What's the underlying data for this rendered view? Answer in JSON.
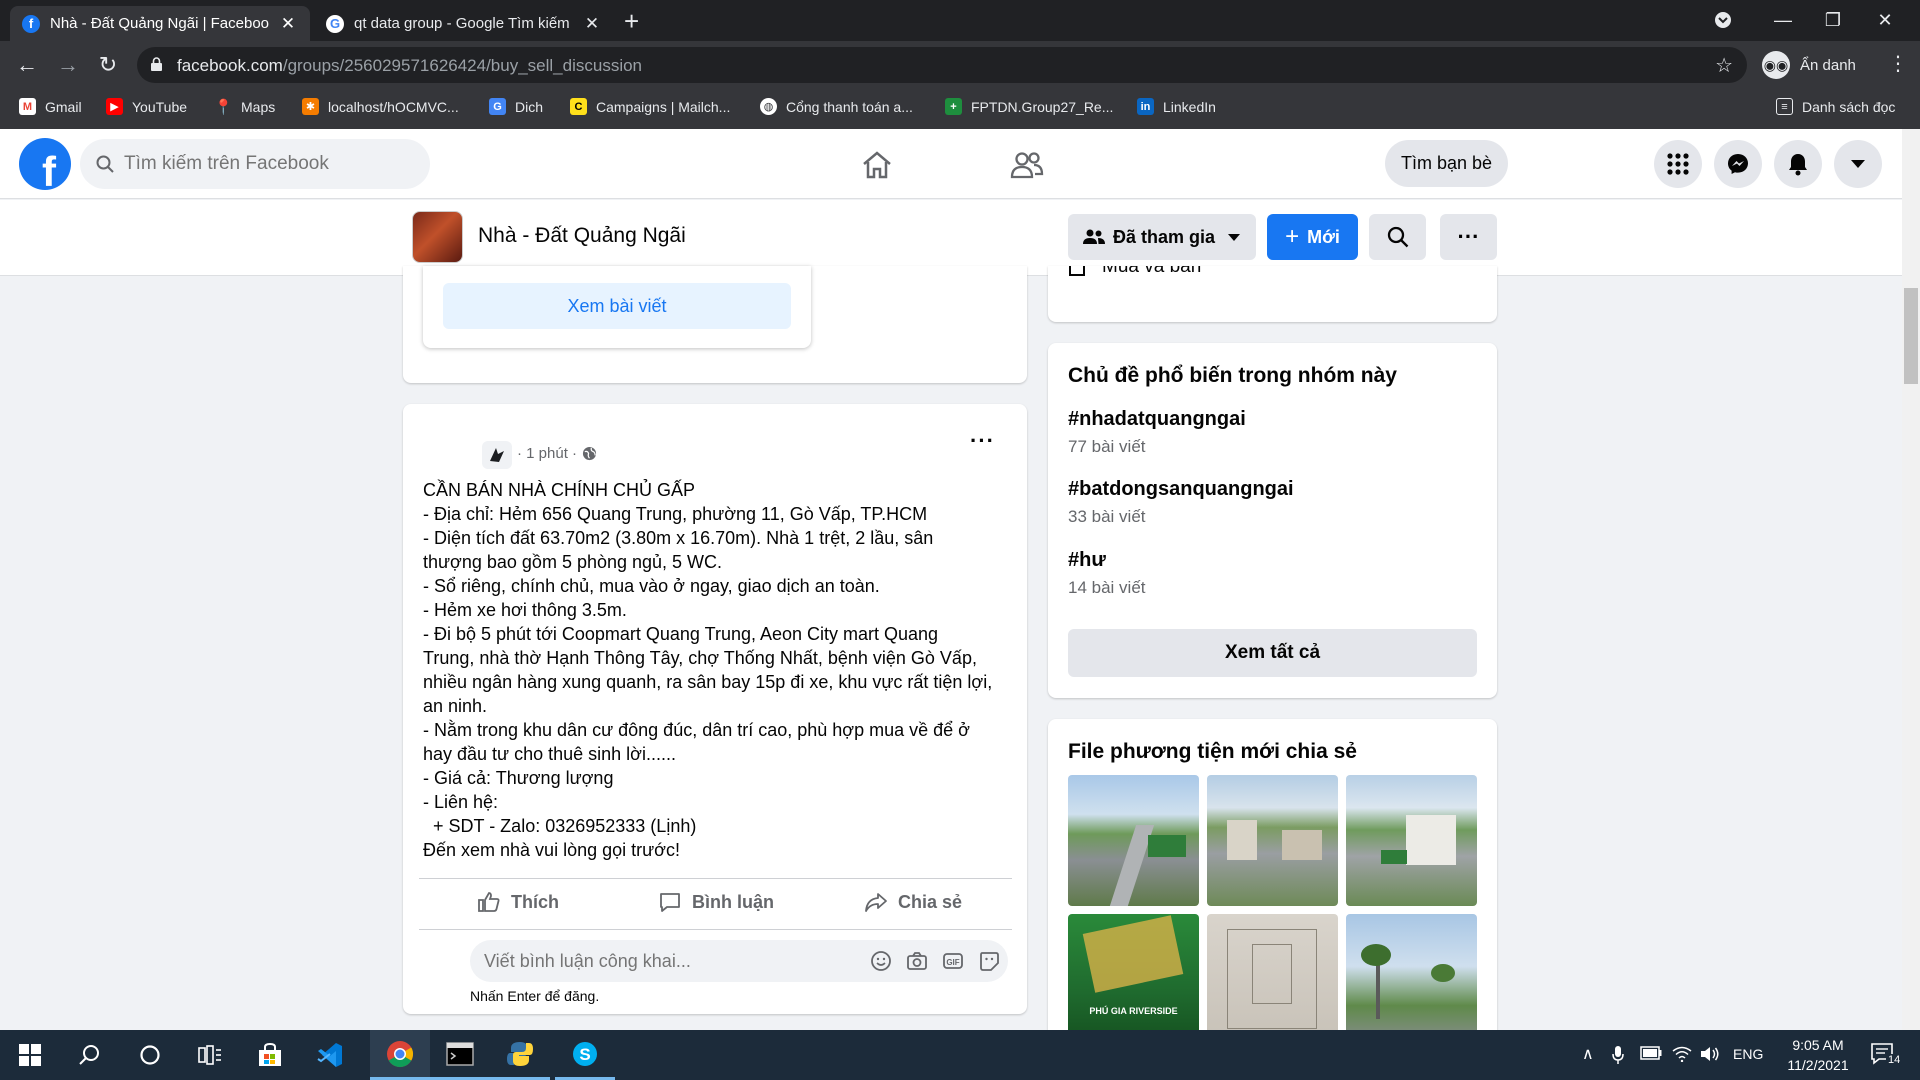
{
  "browser": {
    "tabs": [
      {
        "title": "Nhà - Đất Quảng Ngãi | Facebook",
        "active": true
      },
      {
        "title": "qt data group - Google Tìm kiếm",
        "active": false
      }
    ],
    "url_host": "facebook.com",
    "url_path": "/groups/256029571626424/buy_sell_discussion",
    "profile_label": "Ẩn danh",
    "bookmarks": [
      "Gmail",
      "YouTube",
      "Maps",
      "localhost/hOCMVC...",
      "Dich",
      "Campaigns | Mailch...",
      "Cổng thanh toán a...",
      "FPTDN.Group27_Re...",
      "LinkedIn"
    ],
    "reading_list": "Danh sách đọc"
  },
  "fb": {
    "search_placeholder": "Tìm kiếm trên Facebook",
    "find_friends": "Tìm bạn bè",
    "group_name": "Nhà - Đất Quảng Ngãi",
    "joined_label": "Đã tham gia",
    "new_label": "Mới",
    "partial_item": "Mua và bán",
    "view_post": "Xem bài viết"
  },
  "post": {
    "time": "· 1 phút ·",
    "lines": [
      "CẦN BÁN NHÀ CHÍNH CHỦ GẤP",
      "- Địa chỉ: Hẻm 656 Quang Trung, phường 11,  Gò Vấp, TP.HCM",
      "- Diện tích đất 63.70m2 (3.80m x 16.70m). Nhà 1 trệt, 2 lầu, sân",
      "thượng bao gồm 5 phòng ngủ, 5 WC.",
      "- Sổ riêng, chính chủ, mua vào ở ngay, giao dịch an toàn.",
      "- Hẻm xe hơi thông 3.5m.",
      "- Đi bộ 5 phút tới Coopmart Quang Trung, Aeon City mart Quang",
      "Trung, nhà thờ Hạnh Thông Tây, chợ Thống Nhất, bệnh viện Gò Vấp,",
      "nhiều ngân hàng xung quanh, ra sân bay 15p đi xe, khu vực rất tiện lợi,",
      "an ninh.",
      "- Nằm trong khu dân cư đông đúc, dân trí cao, phù hợp mua về để ở",
      "hay đầu tư cho thuê sinh lời......",
      "- Giá cả: Thương lượng",
      "- Liên hệ:",
      "  + SDT - Zalo: 0326952333 (Lịnh)",
      "Đến xem nhà vui lòng gọi trước!"
    ],
    "like": "Thích",
    "comment": "Bình luận",
    "share": "Chia sẻ",
    "comment_placeholder": "Viết bình luận công khai...",
    "enter_hint": "Nhấn Enter để đăng."
  },
  "sidebar": {
    "topics_title": "Chủ đề phổ biến trong nhóm này",
    "topics": [
      {
        "tag": "#nhadatquangngai",
        "count": "77 bài viết"
      },
      {
        "tag": "#batdongsanquangngai",
        "count": "33 bài viết"
      },
      {
        "tag": "#hư",
        "count": "14 bài viết"
      }
    ],
    "see_all": "Xem tất cả",
    "media_title": "File phương tiện mới chia sẻ",
    "media_caption": "PHÚ GIA RIVERSIDE"
  },
  "taskbar": {
    "lang": "ENG",
    "time": "9:05 AM",
    "date": "11/2/2021",
    "notif_count": "14"
  }
}
